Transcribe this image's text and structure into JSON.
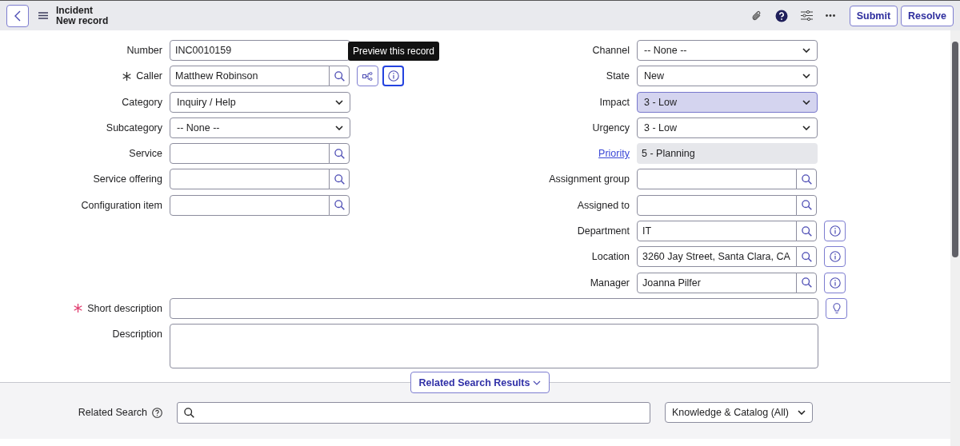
{
  "header": {
    "title": "Incident",
    "subtitle": "New record",
    "buttons": [
      "Submit",
      "Resolve"
    ]
  },
  "tooltip": "Preview this record",
  "left_fields": [
    {
      "label": "Number",
      "kind": "text",
      "value": "INC0010159"
    },
    {
      "label": "Caller",
      "kind": "reference",
      "value": "Matthew Robinson",
      "required": true,
      "satisfied": true,
      "actions": [
        {
          "kind": "dependency",
          "focused": false
        },
        {
          "kind": "info",
          "focused": true
        }
      ]
    },
    {
      "label": "Category",
      "kind": "select",
      "value": "Inquiry / Help"
    },
    {
      "label": "Subcategory",
      "kind": "select",
      "value": "-- None --"
    },
    {
      "label": "Service",
      "kind": "reference"
    },
    {
      "label": "Service offering",
      "kind": "reference"
    },
    {
      "label": "Configuration item",
      "kind": "reference"
    }
  ],
  "right_fields": [
    {
      "label": "Channel",
      "kind": "select",
      "value": "-- None --"
    },
    {
      "label": "State",
      "kind": "select",
      "value": "New"
    },
    {
      "label": "Impact",
      "kind": "select",
      "value": "3 - Low",
      "highlighted": true
    },
    {
      "label": "Urgency",
      "kind": "select",
      "value": "3 - Low",
      "highlighted": false
    },
    {
      "label": "Priority",
      "kind": "readonly",
      "value": "5 - Planning",
      "label_link": true
    },
    {
      "label": "Assignment group",
      "kind": "reference"
    },
    {
      "label": "Assigned to",
      "kind": "reference"
    },
    {
      "label": "Department",
      "kind": "reference",
      "value": "IT",
      "actions": [
        {
          "kind": "info",
          "focused": false
        }
      ]
    },
    {
      "label": "Location",
      "kind": "reference",
      "value": "3260 Jay Street, Santa Clara, CA",
      "actions": [
        {
          "kind": "info",
          "focused": false
        }
      ]
    },
    {
      "label": "Manager",
      "kind": "reference",
      "value": "Joanna Pilfer",
      "actions": [
        {
          "kind": "info",
          "focused": false
        }
      ]
    }
  ],
  "wide_fields": [
    {
      "label": "Short description",
      "kind": "text",
      "required": true,
      "satisfied": false,
      "actions": [
        {
          "kind": "suggest",
          "focused": false
        }
      ]
    },
    {
      "label": "Description",
      "kind": "textarea"
    }
  ],
  "related_toggle": "Related Search Results",
  "related_search": {
    "label": "Related Search",
    "source": "Knowledge & Catalog (All)"
  }
}
